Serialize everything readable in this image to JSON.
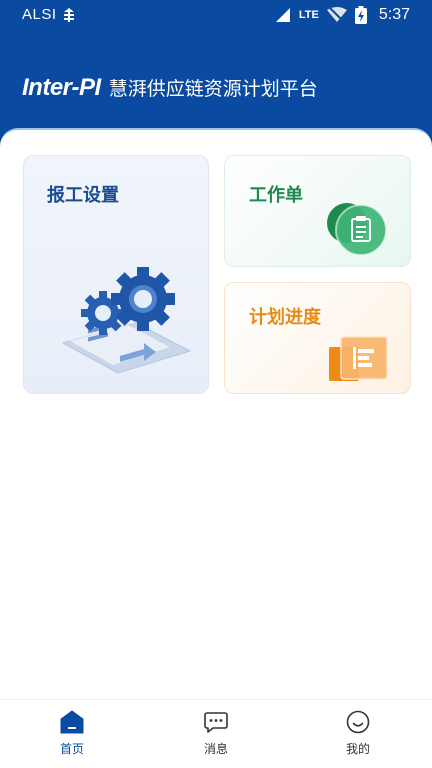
{
  "status_bar": {
    "carrier": "ALSI",
    "network": "LTE",
    "time": "5:37"
  },
  "header": {
    "brand": "Inter-PI",
    "subtitle": "慧湃供应链资源计划平台",
    "color": "#0a4aa0"
  },
  "cards": {
    "report": {
      "label": "报工设置",
      "icon": "gears-document-icon",
      "color": "#1b4b92"
    },
    "work_order": {
      "label": "工作单",
      "icon": "clipboard-icon",
      "color": "#1e8a4f"
    },
    "plan": {
      "label": "计划进度",
      "icon": "progress-chart-icon",
      "color": "#e58b18"
    }
  },
  "tabbar": {
    "items": [
      {
        "label": "首页",
        "icon": "home-icon",
        "active": true
      },
      {
        "label": "消息",
        "icon": "message-icon",
        "active": false
      },
      {
        "label": "我的",
        "icon": "profile-icon",
        "active": false
      }
    ],
    "active_color": "#0a4aa0"
  }
}
